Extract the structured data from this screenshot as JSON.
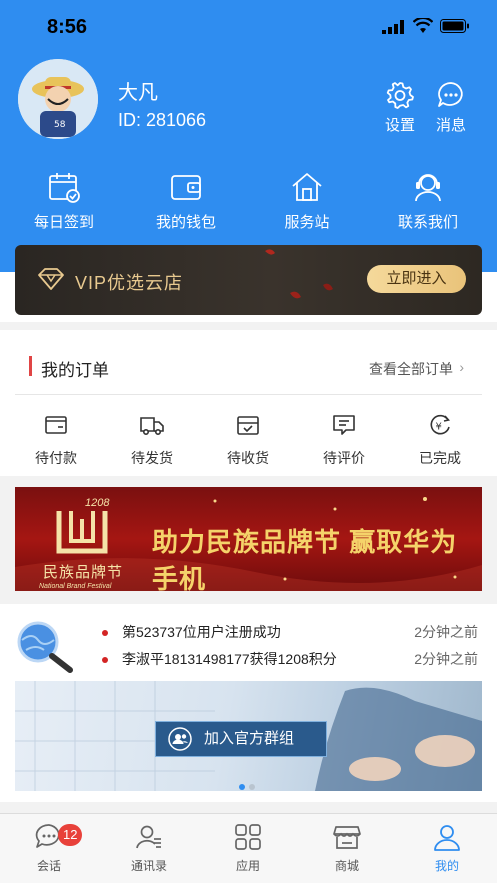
{
  "status_bar": {
    "time": "8:56"
  },
  "profile": {
    "name": "大凡",
    "id_text": "ID: 281066"
  },
  "header_actions": {
    "settings_label": "设置",
    "messages_label": "消息"
  },
  "quick_actions": [
    {
      "label": "每日签到",
      "icon": "calendar-check-icon"
    },
    {
      "label": "我的钱包",
      "icon": "wallet-icon"
    },
    {
      "label": "服务站",
      "icon": "home-icon"
    },
    {
      "label": "联系我们",
      "icon": "customer-service-icon"
    }
  ],
  "vip": {
    "text": "VIP优选云店",
    "button": "立即进入"
  },
  "orders": {
    "title": "我的订单",
    "view_all": "查看全部订单",
    "items": [
      {
        "label": "待付款",
        "icon": "wallet-icon"
      },
      {
        "label": "待发货",
        "icon": "truck-icon"
      },
      {
        "label": "待收货",
        "icon": "box-icon"
      },
      {
        "label": "待评价",
        "icon": "comment-icon"
      },
      {
        "label": "已完成",
        "icon": "yen-refresh-icon"
      }
    ]
  },
  "banner": {
    "logo_year": "1208",
    "logo_text": "民族品牌节",
    "logo_subtext": "National Brand Festival",
    "slogan": "助力民族品牌节 赢取华为手机"
  },
  "news": [
    {
      "text": "第523737位用户注册成功",
      "time": "2分钟之前"
    },
    {
      "text": "李淑平18131498177获得1208积分",
      "time": "2分钟之前"
    }
  ],
  "group_banner": {
    "button": "加入官方群组"
  },
  "tabbar": {
    "items": [
      {
        "label": "会话",
        "icon": "chat-icon",
        "badge": "12"
      },
      {
        "label": "通讯录",
        "icon": "contacts-icon"
      },
      {
        "label": "应用",
        "icon": "apps-grid-icon"
      },
      {
        "label": "商城",
        "icon": "store-icon"
      },
      {
        "label": "我的",
        "icon": "person-icon",
        "active": true
      }
    ]
  },
  "colors": {
    "primary": "#2f8df0",
    "vip_gold": "#e8c98f",
    "badge": "#e8413a",
    "order_bar": "#e04545"
  }
}
